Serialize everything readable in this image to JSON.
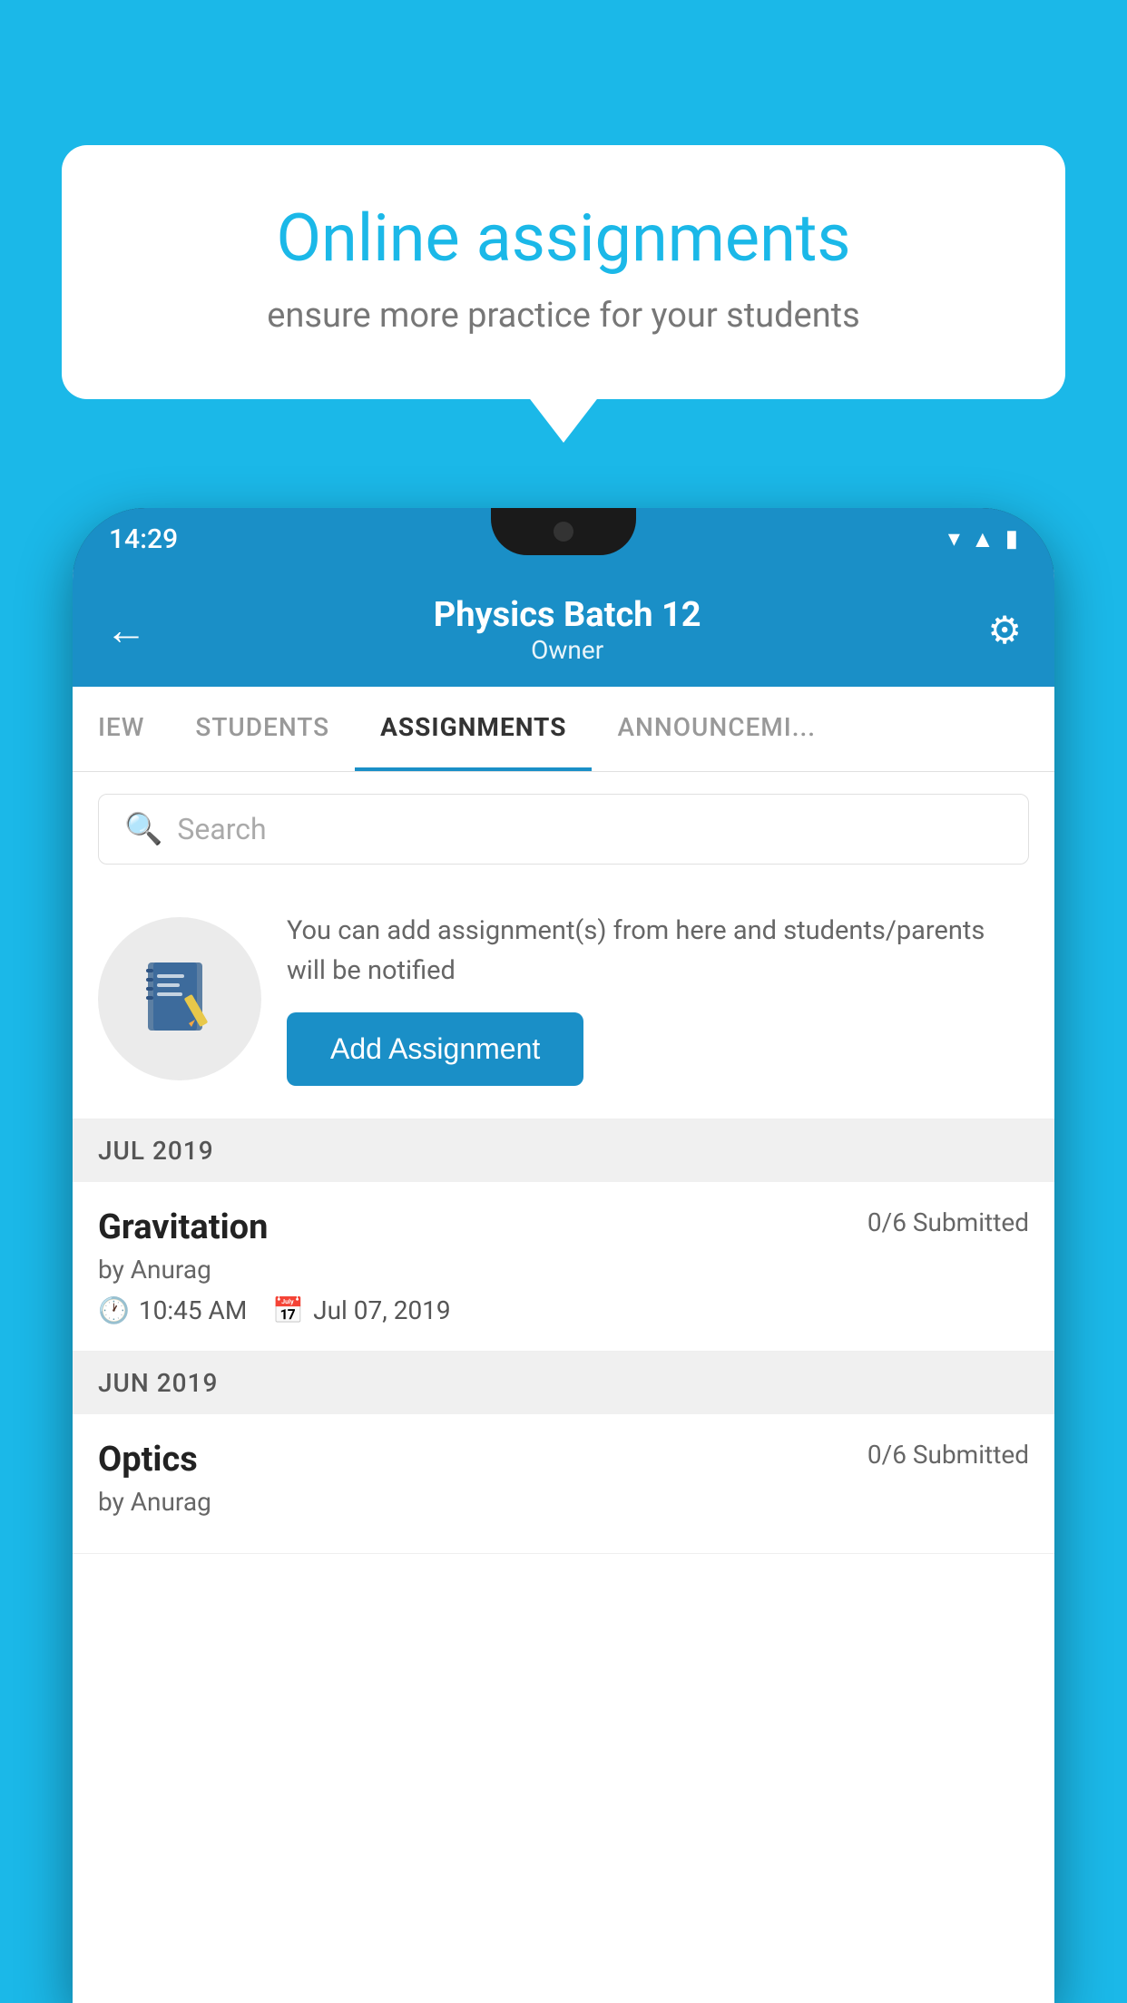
{
  "background_color": "#1BB8E8",
  "speech_bubble": {
    "title": "Online assignments",
    "subtitle": "ensure more practice for your students"
  },
  "phone": {
    "status_bar": {
      "time": "14:29",
      "icons": [
        "wifi",
        "signal",
        "battery"
      ]
    },
    "header": {
      "title": "Physics Batch 12",
      "subtitle": "Owner",
      "back_label": "←",
      "settings_label": "⚙"
    },
    "tabs": [
      {
        "label": "IEW",
        "active": false
      },
      {
        "label": "STUDENTS",
        "active": false
      },
      {
        "label": "ASSIGNMENTS",
        "active": true
      },
      {
        "label": "ANNOUNCEM...",
        "active": false
      }
    ],
    "search": {
      "placeholder": "Search"
    },
    "promo": {
      "text": "You can add assignment(s) from here and students/parents will be notified",
      "button_label": "Add Assignment"
    },
    "assignments": [
      {
        "month_label": "JUL 2019",
        "items": [
          {
            "name": "Gravitation",
            "submitted": "0/6 Submitted",
            "by": "by Anurag",
            "time": "10:45 AM",
            "date": "Jul 07, 2019"
          }
        ]
      },
      {
        "month_label": "JUN 2019",
        "items": [
          {
            "name": "Optics",
            "submitted": "0/6 Submitted",
            "by": "by Anurag",
            "time": "",
            "date": ""
          }
        ]
      }
    ]
  }
}
